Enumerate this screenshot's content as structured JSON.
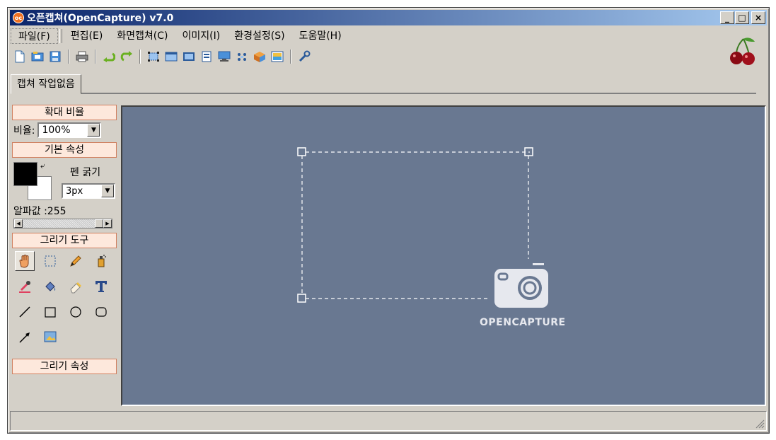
{
  "window": {
    "title": "오픈캡쳐(OpenCapture) v7.0",
    "app_icon_text": "oc",
    "controls": {
      "minimize": "_",
      "maximize": "□",
      "close": "×"
    }
  },
  "menu": [
    {
      "label": "파일(F)"
    },
    {
      "label": "편집(E)"
    },
    {
      "label": "화면캡쳐(C)"
    },
    {
      "label": "이미지(I)"
    },
    {
      "label": "환경설정(S)"
    },
    {
      "label": "도움말(H)"
    }
  ],
  "toolbar": {
    "icons": [
      "new-file-icon",
      "open-folder-icon",
      "save-icon",
      "print-icon",
      "undo-icon",
      "redo-icon",
      "capture-region-icon",
      "capture-window-icon",
      "capture-full-icon",
      "capture-scroll-icon",
      "capture-fixed-icon",
      "capture-multi-icon",
      "package-icon",
      "image-edit-icon",
      "wrench-icon"
    ]
  },
  "tabs": [
    {
      "label": "캡쳐 작업없음"
    }
  ],
  "left_panel": {
    "zoom_section": {
      "header": "확대 비율",
      "label": "비율:",
      "value": "100%"
    },
    "basic_section": {
      "header": "기본 속성",
      "pen_label": "펜 굵기",
      "pen_value": "3px",
      "alpha_label": "알파값 :255",
      "alpha": 255,
      "foreground": "#000000",
      "background": "#ffffff"
    },
    "tools_section": {
      "header": "그리기 도구"
    },
    "draw_props_section": {
      "header": "그리기 속성"
    }
  },
  "canvas": {
    "logo_text": "OPENCAPTURE",
    "background": "#697891"
  },
  "colors": {
    "accent": "#0a246a",
    "section_border": "#d08060",
    "section_bg": "#fde8dc"
  }
}
